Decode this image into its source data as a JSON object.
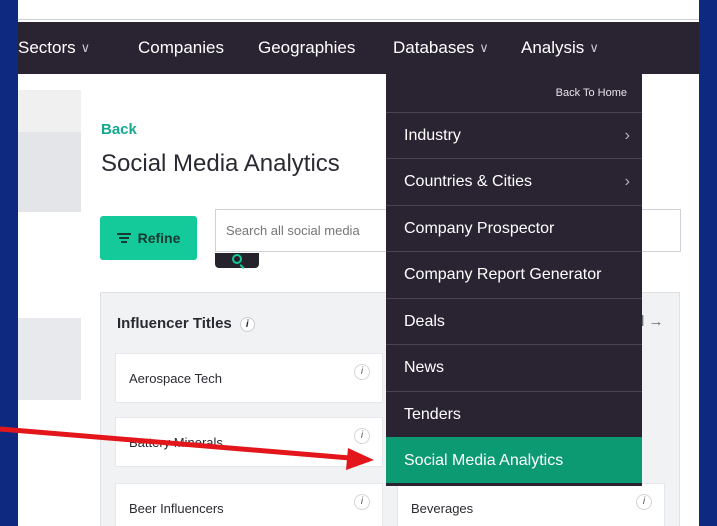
{
  "nav": {
    "sectors": "Sectors",
    "companies": "Companies",
    "geographies": "Geographies",
    "databases": "Databases",
    "analysis": "Analysis"
  },
  "page": {
    "back": "Back",
    "title": "Social Media Analytics"
  },
  "refine": {
    "label": "Refine"
  },
  "search": {
    "placeholder": "Search all social media"
  },
  "panel": {
    "title": "Influencer Titles",
    "info": "i",
    "arrow": "l →",
    "tiles": [
      {
        "label": "Aerospace Tech"
      },
      {
        "label": "Battery Minerals"
      },
      {
        "label": "Beer Influencers"
      },
      {
        "label": "Beverages"
      }
    ]
  },
  "dropdown": {
    "back_home": "Back To Home",
    "items": [
      {
        "label": "Industry",
        "has_submenu": true
      },
      {
        "label": "Countries & Cities",
        "has_submenu": true
      },
      {
        "label": "Company Prospector",
        "has_submenu": false
      },
      {
        "label": "Company Report Generator",
        "has_submenu": false
      },
      {
        "label": "Deals",
        "has_submenu": false
      },
      {
        "label": "News",
        "has_submenu": false
      },
      {
        "label": "Tenders",
        "has_submenu": false
      },
      {
        "label": "Social Media Analytics",
        "has_submenu": false,
        "active": true
      }
    ]
  },
  "colors": {
    "outer_background": "#0d2a80",
    "navbar": "#2a2432",
    "accent_green": "#14c99a",
    "active_item": "#0c9a72",
    "annotation_arrow": "#e3161b"
  }
}
